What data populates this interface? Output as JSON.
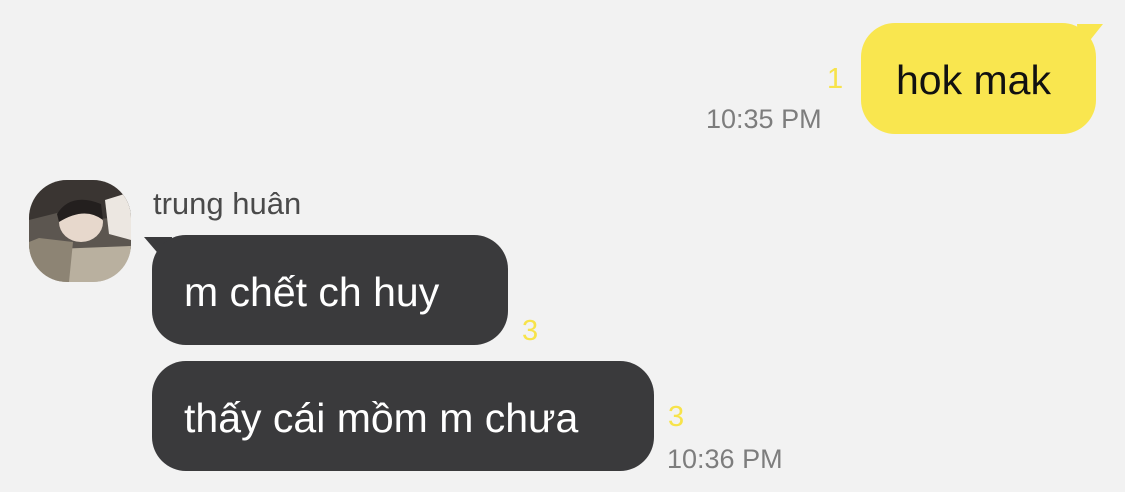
{
  "outgoing": {
    "message": "hok mak",
    "read_count": "1",
    "time": "10:35 PM"
  },
  "incoming": {
    "sender_name": "trung huân",
    "messages": [
      {
        "text": "m chết ch huy",
        "read_count": "3"
      },
      {
        "text": "thấy cái mồm m chưa",
        "read_count": "3"
      }
    ],
    "time": "10:36 PM"
  },
  "colors": {
    "background": "#f2f2f2",
    "outgoing_bubble": "#f9e64f",
    "incoming_bubble": "#3a3a3c",
    "read_count": "#f7e34a",
    "timestamp": "#7d7d7d"
  },
  "icons": {
    "avatar": "profile-photo"
  }
}
